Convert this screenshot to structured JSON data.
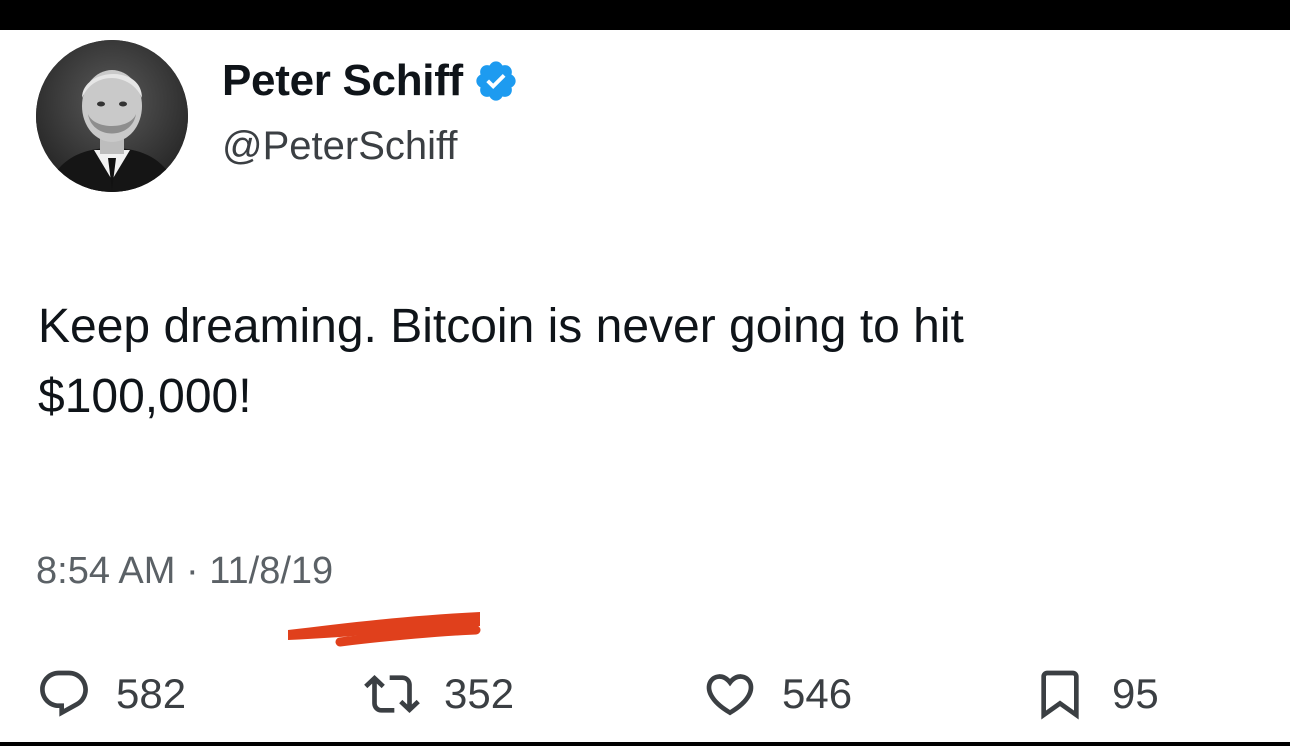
{
  "author": {
    "display_name": "Peter Schiff",
    "handle": "@PeterSchiff",
    "verified": true,
    "verified_color": "#1d9bf0"
  },
  "tweet": {
    "text": "Keep dreaming.  Bitcoin is never going to hit\n$100,000!",
    "time": "8:54 AM",
    "separator": "·",
    "date": "11/8/19",
    "highlight_color": "#e0401c"
  },
  "actions": {
    "reply": {
      "icon": "reply-icon",
      "count": "582"
    },
    "retweet": {
      "icon": "retweet-icon",
      "count": "352"
    },
    "like": {
      "icon": "heart-icon",
      "count": "546"
    },
    "bookmark": {
      "icon": "bookmark-icon",
      "count": "95"
    }
  }
}
